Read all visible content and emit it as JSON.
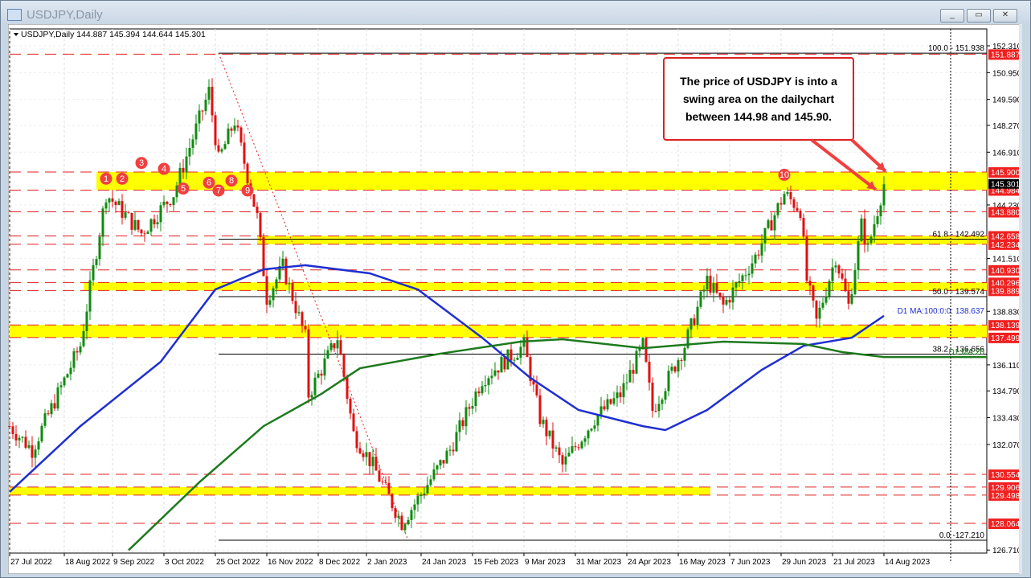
{
  "window": {
    "title": "USDJPY,Daily",
    "buttons": [
      "_",
      "▭",
      "✕"
    ]
  },
  "chart_data": {
    "type": "candlestick",
    "title": "USDJPY,Daily",
    "ohlc_header": "144.887 145.394 144.644 145.301",
    "ylim": [
      126.71,
      152.31
    ],
    "y_ticks": [
      "152.310",
      "150.950",
      "149.590",
      "148.270",
      "146.910",
      "144.230",
      "141.510",
      "138.830",
      "136.110",
      "134.790",
      "133.430",
      "132.070",
      "126.710"
    ],
    "x_ticks": [
      {
        "day": 0,
        "label": "27 Jul 2022"
      },
      {
        "day": 17,
        "label": "18 Aug 2022"
      },
      {
        "day": 32,
        "label": "9 Sep 2022"
      },
      {
        "day": 48,
        "label": "3 Oct 2022"
      },
      {
        "day": 64,
        "label": "25 Oct 2022"
      },
      {
        "day": 80,
        "label": "16 Nov 2022"
      },
      {
        "day": 96,
        "label": "8 Dec 2022"
      },
      {
        "day": 111,
        "label": "2 Jan 2023"
      },
      {
        "day": 128,
        "label": "24 Jan 2023"
      },
      {
        "day": 144,
        "label": "15 Feb 2023"
      },
      {
        "day": 160,
        "label": "9 Mar 2023"
      },
      {
        "day": 176,
        "label": "31 Mar 2023"
      },
      {
        "day": 192,
        "label": "24 Apr 2023"
      },
      {
        "day": 208,
        "label": "16 May 2023"
      },
      {
        "day": 224,
        "label": "7 Jun 2023"
      },
      {
        "day": 240,
        "label": "29 Jun 2023"
      },
      {
        "day": 256,
        "label": "21 Jul 2023"
      },
      {
        "day": 272,
        "label": "14 Aug 2023"
      }
    ],
    "price_path": [
      [
        0,
        133.0
      ],
      [
        7,
        131.8
      ],
      [
        22,
        137.1
      ],
      [
        30,
        144.8
      ],
      [
        41,
        142.8
      ],
      [
        51,
        144.8
      ],
      [
        62,
        150.0
      ],
      [
        65,
        146.5
      ],
      [
        70,
        148.5
      ],
      [
        77,
        143.6
      ],
      [
        80,
        139.5
      ],
      [
        85,
        141.1
      ],
      [
        92,
        137.5
      ],
      [
        93,
        134.6
      ],
      [
        102,
        137.5
      ],
      [
        107,
        132.6
      ],
      [
        113,
        131.0
      ],
      [
        122,
        128.1
      ],
      [
        127,
        129.3
      ],
      [
        137,
        131.8
      ],
      [
        147,
        135.4
      ],
      [
        160,
        137.1
      ],
      [
        165,
        133.4
      ],
      [
        172,
        131.0
      ],
      [
        182,
        133.4
      ],
      [
        190,
        134.6
      ],
      [
        197,
        137.1
      ],
      [
        200,
        133.8
      ],
      [
        210,
        137.1
      ],
      [
        217,
        140.4
      ],
      [
        222,
        139.1
      ],
      [
        232,
        141.6
      ],
      [
        241,
        144.8
      ],
      [
        246,
        144.0
      ],
      [
        248,
        140.4
      ],
      [
        251,
        138.3
      ],
      [
        257,
        141.6
      ],
      [
        261,
        139.1
      ],
      [
        265,
        143.2
      ],
      [
        267,
        142.0
      ],
      [
        272,
        145.3
      ]
    ],
    "moving_averages": [
      {
        "name": "D1 MA:100:0:0: 138.637",
        "color": "#1f2fd0",
        "points": [
          [
            0,
            129.66
          ],
          [
            22,
            133.0
          ],
          [
            47,
            136.27
          ],
          [
            64,
            139.94
          ],
          [
            79,
            140.96
          ],
          [
            92,
            141.17
          ],
          [
            112,
            140.76
          ],
          [
            127,
            139.94
          ],
          [
            147,
            137.49
          ],
          [
            162,
            135.45
          ],
          [
            177,
            133.82
          ],
          [
            197,
            133.0
          ],
          [
            204,
            132.8
          ],
          [
            217,
            133.82
          ],
          [
            234,
            135.86
          ],
          [
            247,
            137.08
          ],
          [
            262,
            137.49
          ],
          [
            272,
            138.6
          ]
        ]
      },
      {
        "name": "D1 MA:20",
        "color": "#1d7a1d",
        "points": [
          [
            37,
            126.7
          ],
          [
            59,
            130.15
          ],
          [
            79,
            133.0
          ],
          [
            97,
            134.64
          ],
          [
            109,
            135.94
          ],
          [
            134,
            136.68
          ],
          [
            159,
            137.29
          ],
          [
            172,
            137.41
          ],
          [
            197,
            136.96
          ],
          [
            222,
            137.29
          ],
          [
            247,
            137.17
          ],
          [
            259,
            136.76
          ],
          [
            272,
            136.51
          ],
          [
            304,
            136.51
          ]
        ]
      }
    ],
    "levels": [
      151.887,
      145.9,
      144.984,
      143.88,
      142.658,
      142.234,
      140.93,
      140.296,
      139.889,
      138.139,
      137.499,
      130.554,
      129.906,
      129.498,
      128.064
    ],
    "zones": [
      {
        "from": 144.984,
        "to": 145.9,
        "start": 27
      },
      {
        "from": 142.234,
        "to": 142.658,
        "start": 77
      },
      {
        "from": 139.889,
        "to": 140.296,
        "start": 23
      },
      {
        "from": 137.499,
        "to": 138.139,
        "start": 0
      },
      {
        "from": 129.498,
        "to": 129.906,
        "start": 0,
        "end": 218
      }
    ],
    "fib_levels": [
      {
        "label": "100.0 - 151.938",
        "price": 151.938
      },
      {
        "label": "61.8 - 142.492",
        "price": 142.492
      },
      {
        "label": "50.0 - 139.574",
        "price": 139.574
      },
      {
        "label": "38.2 - 136.656",
        "price": 136.656
      },
      {
        "label": "0.0 -127.210",
        "price": 127.21
      }
    ],
    "current_price": "145.301",
    "touches": [
      {
        "n": "1",
        "day": 30,
        "price": 145.4
      },
      {
        "n": "2",
        "day": 35,
        "price": 145.4
      },
      {
        "n": "3",
        "day": 41,
        "price": 146.2
      },
      {
        "n": "4",
        "day": 48,
        "price": 145.9
      },
      {
        "n": "5",
        "day": 54,
        "price": 144.9
      },
      {
        "n": "6",
        "day": 62,
        "price": 145.2
      },
      {
        "n": "7",
        "day": 65,
        "price": 144.8
      },
      {
        "n": "8",
        "day": 69,
        "price": 145.3
      },
      {
        "n": "9",
        "day": 74,
        "price": 144.8
      },
      {
        "n": "10",
        "day": 241,
        "price": 145.6
      }
    ],
    "annotation": [
      "The price of USDJPY is into a",
      "swing area on the dailychart",
      "between 144.98 and 145.90."
    ]
  }
}
